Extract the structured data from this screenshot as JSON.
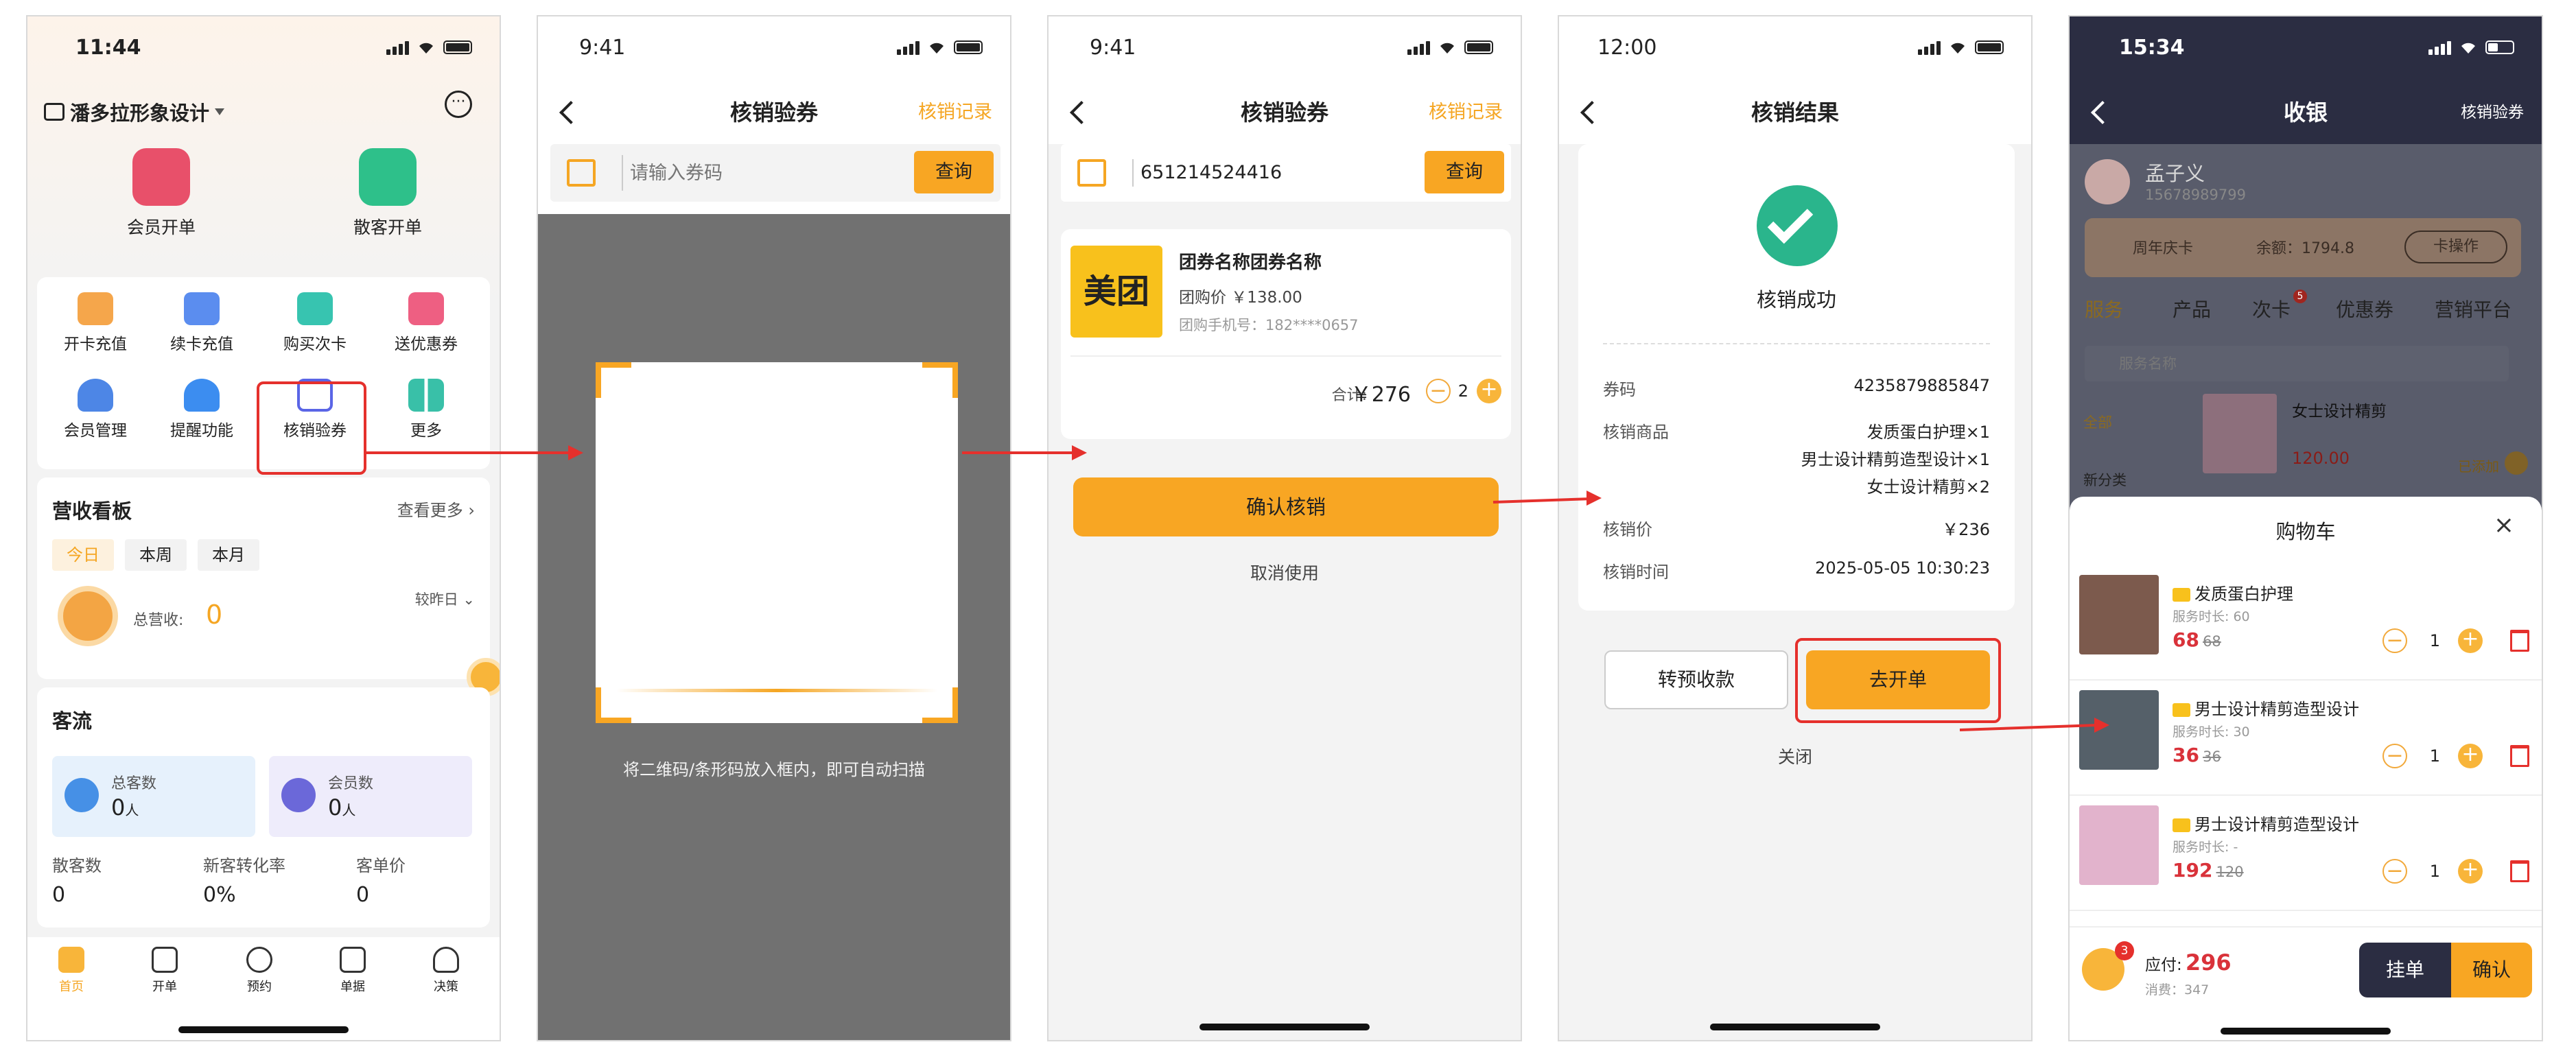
{
  "p1": {
    "time": "11:44",
    "store": "潘多拉形象设计",
    "top_actions": [
      "会员开单",
      "散客开单"
    ],
    "grid": [
      "开卡充值",
      "续卡充值",
      "购买次卡",
      "送优惠券",
      "会员管理",
      "提醒功能",
      "核销验券",
      "更多"
    ],
    "revenue": {
      "title": "营收看板",
      "more": "查看更多",
      "periods": [
        "今日",
        "本周",
        "本月"
      ],
      "compare": "较昨日",
      "total_label": "总营收:",
      "total": "0"
    },
    "traffic": {
      "title": "客流",
      "total_label": "总客数",
      "total": "0",
      "member_label": "会员数",
      "member": "0",
      "unit": "人",
      "stats": [
        {
          "label": "散客数",
          "value": "0"
        },
        {
          "label": "新客转化率",
          "value": "0%"
        },
        {
          "label": "客单价",
          "value": "0"
        }
      ]
    },
    "tabs": [
      "首页",
      "开单",
      "预约",
      "单据",
      "决策"
    ]
  },
  "p2": {
    "time": "9:41",
    "title": "核销验券",
    "record": "核销记录",
    "placeholder": "请输入券码",
    "query": "查询",
    "hint": "将二维码/条形码放入框内，即可自动扫描"
  },
  "p3": {
    "time": "9:41",
    "title": "核销验券",
    "record": "核销记录",
    "code": "651214524416",
    "query": "查询",
    "coupon": {
      "brand": "美团",
      "name": "团券名称团券名称",
      "price": "团购价 ￥138.00",
      "phone": "团购手机号：182****0657",
      "total_label": "合计:",
      "total": "￥276",
      "qty": "2"
    },
    "confirm": "确认核销",
    "cancel": "取消使用"
  },
  "p4": {
    "time": "12:00",
    "title": "核销结果",
    "success": "核销成功",
    "rows": [
      {
        "label": "券码",
        "value": "4235879885847"
      },
      {
        "label": "核销商品",
        "value": "发质蛋白护理×1"
      },
      {
        "label": "",
        "value": "男士设计精剪造型设计×1"
      },
      {
        "label": "",
        "value": "女士设计精剪×2"
      },
      {
        "label": "核销价",
        "value": "￥236"
      },
      {
        "label": "核销时间",
        "value": "2025-05-05 10:30:23"
      }
    ],
    "btn_prepay": "转预收款",
    "btn_open": "去开单",
    "close": "关闭"
  },
  "p5": {
    "time": "15:34",
    "title": "收银",
    "verify": "核销验券",
    "member": {
      "name": "孟子义",
      "phone": "15678989799"
    },
    "card": {
      "name": "周年庆卡",
      "balance": "余额：1794.8",
      "op": "卡操作"
    },
    "tabs": [
      "服务",
      "产品",
      "次卡",
      "优惠券",
      "营销平台"
    ],
    "badge": "5",
    "search": "服务名称",
    "cats": [
      "全部",
      "新分类"
    ],
    "item": {
      "name": "女士设计精剪",
      "price": "120.00",
      "added": "已添加"
    },
    "cart_title": "购物车",
    "cart": [
      {
        "name": "发质蛋白护理",
        "dur": "服务时长: 60",
        "price": "68",
        "orig": "68",
        "qty": "1"
      },
      {
        "name": "男士设计精剪造型设计",
        "dur": "服务时长: 30",
        "price": "36",
        "orig": "36",
        "qty": "1"
      },
      {
        "name": "男士设计精剪造型设计",
        "dur": "服务时长: -",
        "price": "192",
        "orig": "120",
        "qty": "1"
      }
    ],
    "cart_count": "3",
    "pay_label": "应付:",
    "pay": "296",
    "consume": "消费：347",
    "hold": "挂单",
    "confirm": "确认"
  }
}
